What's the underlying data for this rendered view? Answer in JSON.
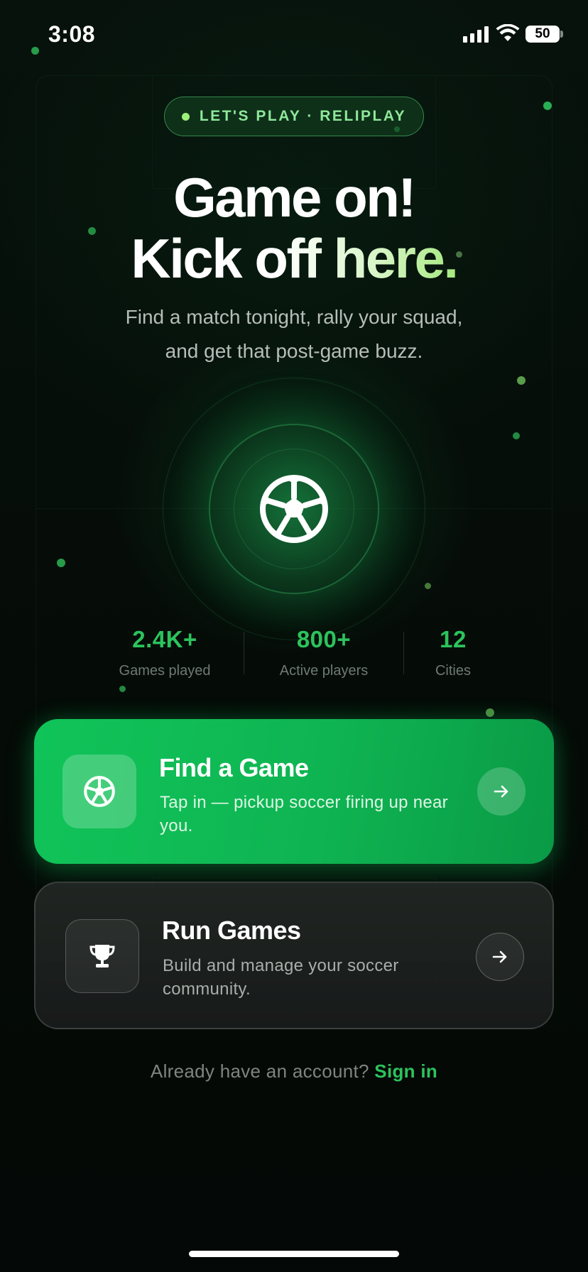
{
  "status_bar": {
    "time": "3:08",
    "battery": "50"
  },
  "badge": {
    "text": "LET'S PLAY · RELIPLAY"
  },
  "headline": {
    "line1": "Game on!",
    "line2": "Kick off here."
  },
  "subtitle": {
    "line1": "Find a match tonight, rally your squad,",
    "line2": "and get that post-game buzz."
  },
  "hero": {
    "icon": "soccer-ball-icon"
  },
  "stats": [
    {
      "value": "2.4K+",
      "label": "Games played"
    },
    {
      "value": "800+",
      "label": "Active players"
    },
    {
      "value": "12",
      "label": "Cities"
    }
  ],
  "cards": {
    "find": {
      "title": "Find a Game",
      "description": "Tap in — pickup soccer firing up near you.",
      "icon": "soccer-ball-icon",
      "action_icon": "arrow-right-icon"
    },
    "run": {
      "title": "Run Games",
      "description": "Build and manage your soccer community.",
      "icon": "trophy-icon",
      "action_icon": "arrow-right-icon"
    }
  },
  "footer": {
    "question": "Already have an account?",
    "link": "Sign in"
  },
  "colors": {
    "accent": "#2cc35c",
    "card_green": "#10c459",
    "background": "#050a07",
    "badge_text": "#8fe89a"
  }
}
